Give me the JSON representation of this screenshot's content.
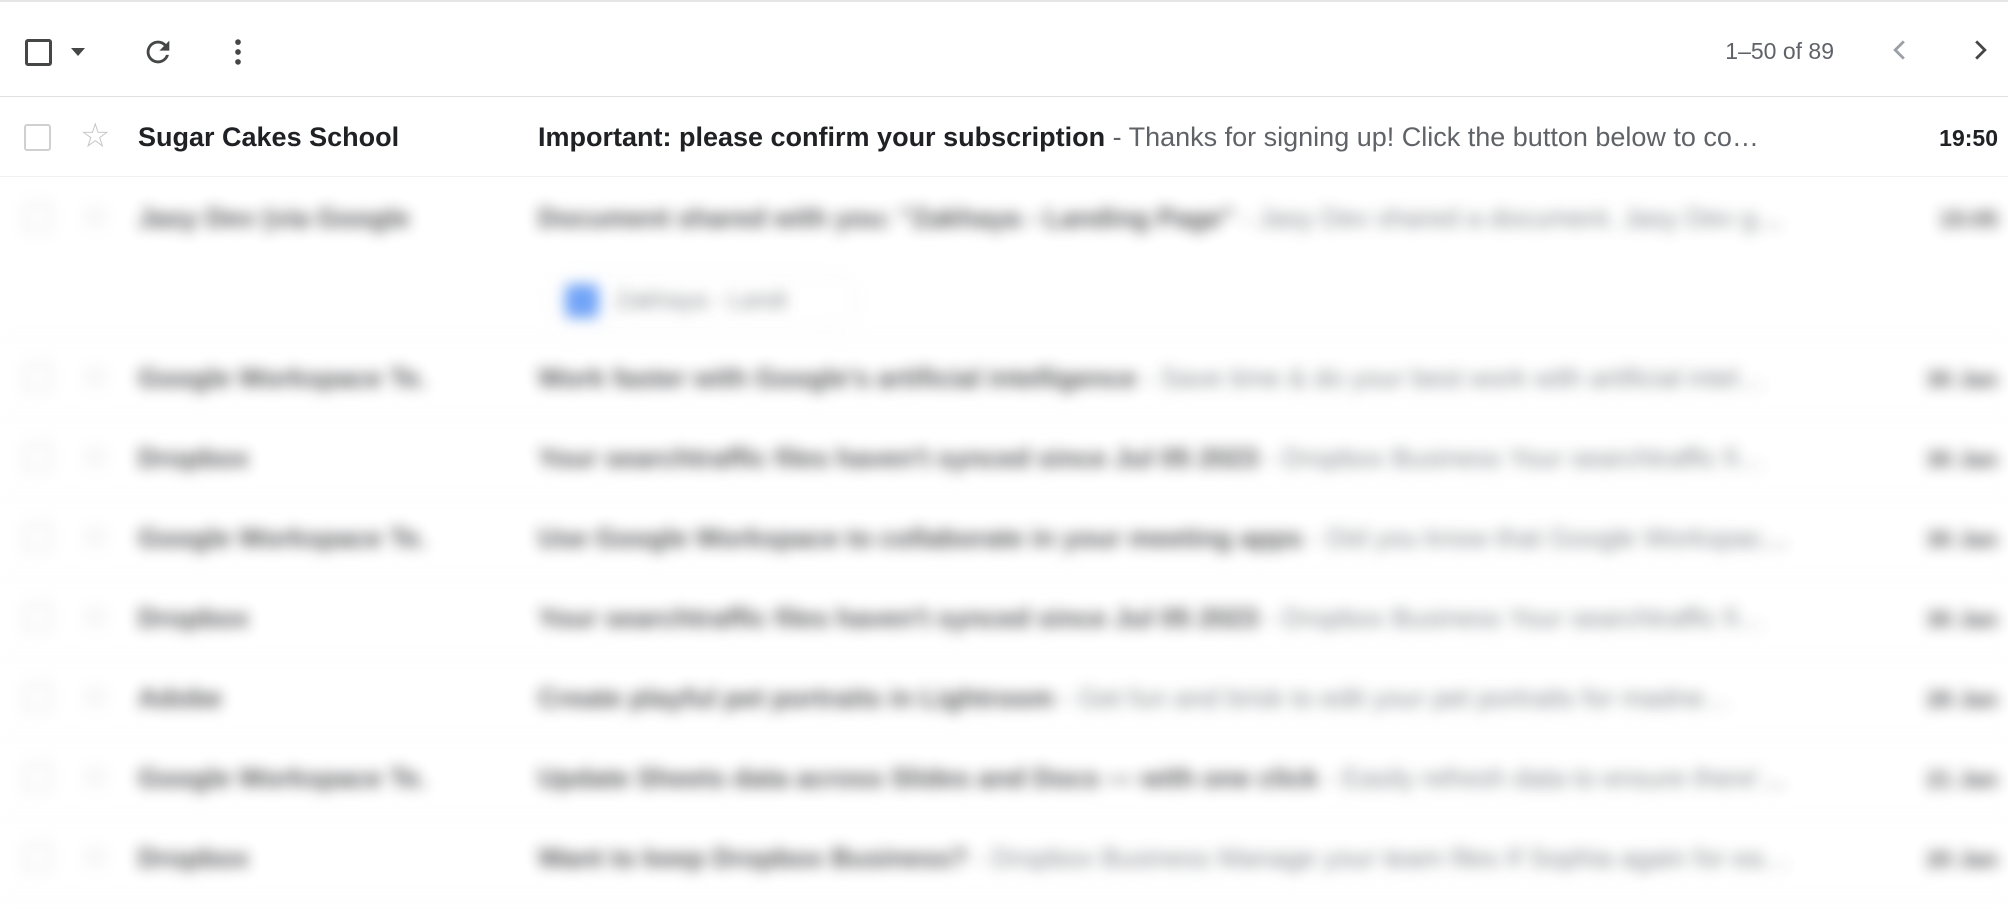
{
  "toolbar": {
    "select_icon": "checkbox-icon",
    "select_menu_icon": "caret-down-icon",
    "refresh_icon": "refresh-icon",
    "more_icon": "more-vert-icon",
    "range": "1–50 of 89",
    "prev_icon": "chevron-left-icon",
    "next_icon": "chevron-right-icon"
  },
  "emails": [
    {
      "sender": "Sugar Cakes School",
      "subject": "Important: please confirm your subscription",
      "snippet": " - Thanks for signing up! Click the button below to co…",
      "time": "19:50",
      "unread": true
    }
  ],
  "blurred_rows": [
    {
      "sender": "Jasy Dev (via Google",
      "subject": "Document shared with you: \"Zakhaya - Landing Page\"",
      "snippet": " - Jasy Dev shared a document. Jasy Dev ga…",
      "time": "15:05",
      "attachment": "Zakhaya - Landi"
    },
    {
      "sender": "Google Workspace Te.",
      "subject": "Work faster with Google's artificial intelligence",
      "snippet": " - Save time & do your best work with artificial intel…",
      "time": "30 Jan"
    },
    {
      "sender": "Dropbox",
      "subject": "Your searchtraffic files haven't synced since Jul 05 2023",
      "snippet": " - Dropbox Business Your searchtraffic fi…",
      "time": "30 Jan"
    },
    {
      "sender": "Google Workspace Te.",
      "subject": "Use Google Workspace to collaborate in your meeting apps",
      "snippet": " - Did you know that Google Workspace…",
      "time": "30 Jan"
    },
    {
      "sender": "Dropbox",
      "subject": "Your searchtraffic files haven't synced since Jul 05 2023",
      "snippet": " - Dropbox Business Your searchtraffic fi…",
      "time": "30 Jan"
    },
    {
      "sender": "Adobe",
      "subject": "Create playful pet portraits in Lightroom",
      "snippet": " - Get fun and brisk to edit your pet portraits for madne…",
      "time": "28 Jan"
    },
    {
      "sender": "Google Workspace Te.",
      "subject": "Update Sheets data across Slides and Docs — with one click",
      "snippet": " - Easily refresh data to ensure there's…",
      "time": "21 Jan"
    },
    {
      "sender": "Dropbox",
      "subject": "Want to keep Dropbox Business?",
      "snippet": " - Dropbox Business Manage your team files If Sophia again for ea…",
      "time": "20 Jan"
    }
  ]
}
